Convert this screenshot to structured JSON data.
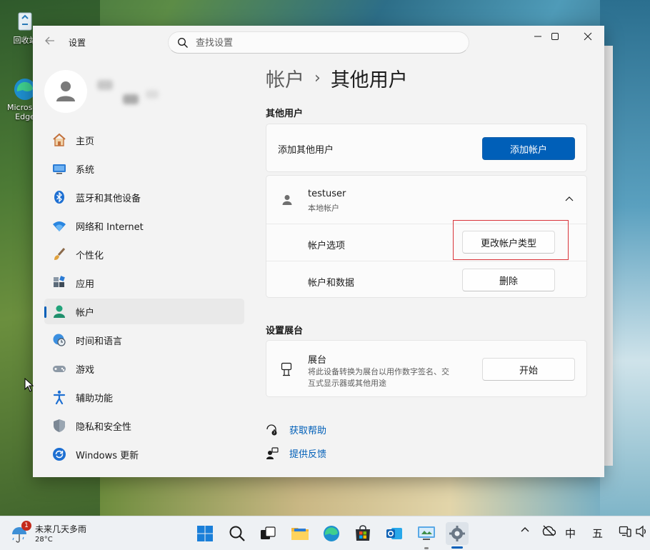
{
  "desktop": {
    "recycle_bin_label": "回收站",
    "edge_label": "Microsoft Edge"
  },
  "window": {
    "app_title": "设置",
    "search_placeholder": "查找设置",
    "controls": {
      "minimize": "—",
      "maximize": "☐",
      "close": "✕"
    }
  },
  "sidebar": {
    "items": [
      {
        "label": "主页",
        "icon": "home-icon",
        "active": false
      },
      {
        "label": "系统",
        "icon": "system-icon",
        "active": false
      },
      {
        "label": "蓝牙和其他设备",
        "icon": "bluetooth-icon",
        "active": false
      },
      {
        "label": "网络和 Internet",
        "icon": "wifi-icon",
        "active": false
      },
      {
        "label": "个性化",
        "icon": "brush-icon",
        "active": false
      },
      {
        "label": "应用",
        "icon": "apps-icon",
        "active": false
      },
      {
        "label": "帐户",
        "icon": "account-icon",
        "active": true
      },
      {
        "label": "时间和语言",
        "icon": "globe-clock-icon",
        "active": false
      },
      {
        "label": "游戏",
        "icon": "gamepad-icon",
        "active": false
      },
      {
        "label": "辅助功能",
        "icon": "accessibility-icon",
        "active": false
      },
      {
        "label": "隐私和安全性",
        "icon": "shield-icon",
        "active": false
      },
      {
        "label": "Windows 更新",
        "icon": "update-icon",
        "active": false
      }
    ]
  },
  "main": {
    "breadcrumb_parent": "帐户",
    "breadcrumb_separator": "›",
    "breadcrumb_current": "其他用户",
    "other_users_section": "其他用户",
    "add_other_user_label": "添加其他用户",
    "add_account_button": "添加帐户",
    "user": {
      "name": "testuser",
      "type": "本地帐户",
      "account_options_label": "帐户选项",
      "change_type_button": "更改帐户类型",
      "account_data_label": "帐户和数据",
      "delete_button": "删除"
    },
    "kiosk_section": "设置展台",
    "kiosk": {
      "title": "展台",
      "description_line1": "将此设备转换为展台以用作数字签名、交",
      "description_line2": "互式显示器或其他用途",
      "start_button": "开始"
    },
    "help_link": "获取帮助",
    "feedback_link": "提供反馈"
  },
  "taskbar": {
    "weather_badge": "1",
    "weather_title": "未来几天多雨",
    "weather_temp": "28°C",
    "tray_ime_1": "中",
    "tray_ime_2": "五"
  },
  "colors": {
    "accent": "#005fb8",
    "highlight_box": "#d9343a",
    "window_bg": "#f3f3f3",
    "card_bg": "#fbfbfb"
  }
}
